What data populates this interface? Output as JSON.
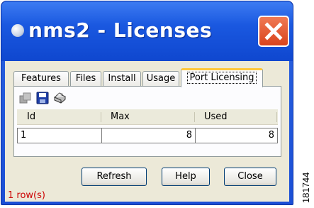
{
  "window": {
    "title": "nms2 - Licenses"
  },
  "tabs": [
    {
      "label": "Features",
      "active": false
    },
    {
      "label": "Files",
      "active": false
    },
    {
      "label": "Install",
      "active": false
    },
    {
      "label": "Usage",
      "active": false
    },
    {
      "label": "Port Licensing",
      "active": true
    }
  ],
  "toolbar": {
    "icons": [
      "copy-icon",
      "save-icon",
      "print-icon"
    ]
  },
  "table": {
    "columns": [
      "Id",
      "Max",
      "Used"
    ],
    "rows": [
      [
        "1",
        "8",
        "8"
      ]
    ]
  },
  "buttons": {
    "refresh": "Refresh",
    "help": "Help",
    "close": "Close"
  },
  "status": "1 row(s)",
  "figure_id": "181744",
  "colors": {
    "titlebar": "#1a58e0",
    "close_button": "#d9431c",
    "active_tab_accent": "#ffc83c",
    "status_text": "#cc0000",
    "dialog_background": "#ece9d8"
  }
}
